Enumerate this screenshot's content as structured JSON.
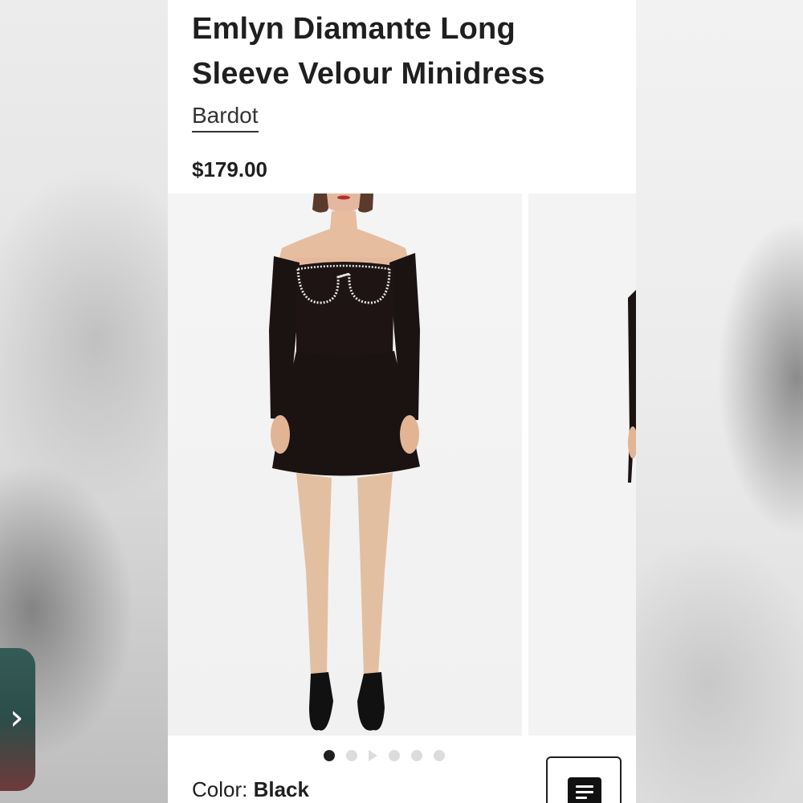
{
  "product": {
    "title": "Emlyn Diamante Long Sleeve Velour Minidress",
    "brand": "Bardot",
    "price": "$179.00"
  },
  "gallery": {
    "slide_count": 6,
    "active_slide": 1,
    "next_label": "›"
  },
  "color": {
    "label": "Color: ",
    "value": "Black"
  },
  "colors": {
    "text": "#1f1f1f",
    "dress": "#1b1212",
    "accent_tab": "#2c4d49"
  }
}
